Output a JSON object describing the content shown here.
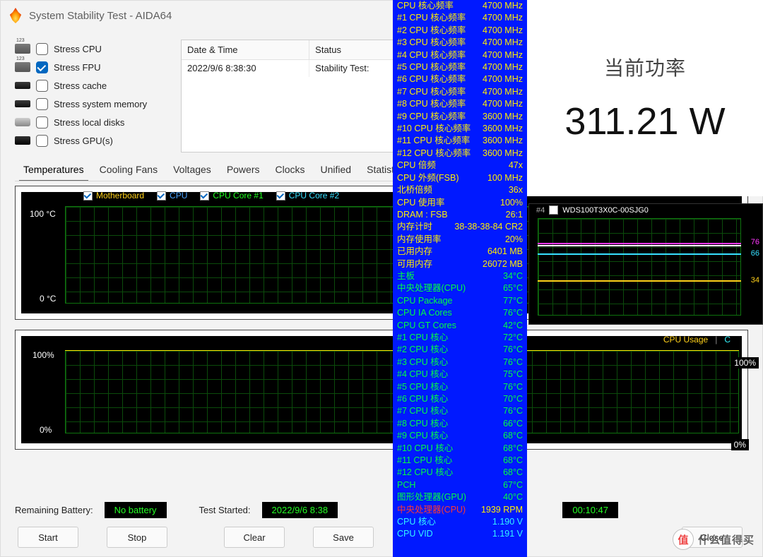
{
  "window": {
    "title": "System Stability Test - AIDA64"
  },
  "stress": {
    "items": [
      {
        "label": "Stress CPU",
        "checked": false,
        "icon": "cpu"
      },
      {
        "label": "Stress FPU",
        "checked": true,
        "icon": "cpu"
      },
      {
        "label": "Stress cache",
        "checked": false,
        "icon": "ram"
      },
      {
        "label": "Stress system memory",
        "checked": false,
        "icon": "ram"
      },
      {
        "label": "Stress local disks",
        "checked": false,
        "icon": "disk"
      },
      {
        "label": "Stress GPU(s)",
        "checked": false,
        "icon": "gpu"
      }
    ]
  },
  "log": {
    "col_date": "Date & Time",
    "col_status": "Status",
    "rows": [
      {
        "dt": "2022/9/6 8:38:30",
        "status": "Stability Test:"
      }
    ]
  },
  "tabs": [
    "Temperatures",
    "Cooling Fans",
    "Voltages",
    "Powers",
    "Clocks",
    "Unified",
    "Statistic"
  ],
  "active_tab": "Temperatures",
  "temp_graph": {
    "y_top": "100 °C",
    "y_bot": "0 °C",
    "legend": [
      {
        "label": "Motherboard",
        "color": "legend-yellow"
      },
      {
        "label": "CPU",
        "color": "legend-blue"
      },
      {
        "label": "CPU Core #1",
        "color": "legend-green"
      },
      {
        "label": "CPU Core #2",
        "color": "legend-cyan"
      }
    ]
  },
  "usage_graph": {
    "y_top": "100%",
    "y_bot": "0%",
    "legend_left": "CPU Usage",
    "sep": "|",
    "legend_right_frag": "C"
  },
  "mini": {
    "idx": "#4",
    "device": "WDS100T3X0C-00SJG0",
    "vals": {
      "v76a": "76",
      "v76b": "76",
      "v66": "66",
      "v34": "34"
    }
  },
  "status": {
    "battery_label": "Remaining Battery:",
    "battery_value": "No battery",
    "started_label": "Test Started:",
    "started_value": "2022/9/6 8:38",
    "elapsed": "00:10:47"
  },
  "buttons": {
    "start": "Start",
    "stop": "Stop",
    "clear": "Clear",
    "save": "Save",
    "close": "Close"
  },
  "power": {
    "title": "当前功率",
    "value": "311.21 W"
  },
  "monitor": [
    {
      "lab": "CPU 核心频率",
      "val": "4700 MHz",
      "lc": "mlab",
      "vc": "mval"
    },
    {
      "lab": "#1 CPU 核心频率",
      "val": "4700 MHz",
      "lc": "mlab",
      "vc": "mval"
    },
    {
      "lab": "#2 CPU 核心频率",
      "val": "4700 MHz",
      "lc": "mlab",
      "vc": "mval"
    },
    {
      "lab": "#3 CPU 核心频率",
      "val": "4700 MHz",
      "lc": "mlab",
      "vc": "mval"
    },
    {
      "lab": "#4 CPU 核心频率",
      "val": "4700 MHz",
      "lc": "mlab",
      "vc": "mval"
    },
    {
      "lab": "#5 CPU 核心频率",
      "val": "4700 MHz",
      "lc": "mlab",
      "vc": "mval"
    },
    {
      "lab": "#6 CPU 核心频率",
      "val": "4700 MHz",
      "lc": "mlab",
      "vc": "mval"
    },
    {
      "lab": "#7 CPU 核心频率",
      "val": "4700 MHz",
      "lc": "mlab",
      "vc": "mval"
    },
    {
      "lab": "#8 CPU 核心频率",
      "val": "4700 MHz",
      "lc": "mlab",
      "vc": "mval"
    },
    {
      "lab": "#9 CPU 核心频率",
      "val": "3600 MHz",
      "lc": "mlab",
      "vc": "mval"
    },
    {
      "lab": "#10 CPU 核心频率",
      "val": "3600 MHz",
      "lc": "mlab",
      "vc": "mval"
    },
    {
      "lab": "#11 CPU 核心频率",
      "val": "3600 MHz",
      "lc": "mlab",
      "vc": "mval"
    },
    {
      "lab": "#12 CPU 核心频率",
      "val": "3600 MHz",
      "lc": "mlab",
      "vc": "mval"
    },
    {
      "lab": "CPU 倍频",
      "val": "47x",
      "lc": "mlab",
      "vc": "mval"
    },
    {
      "lab": "CPU 外频(FSB)",
      "val": "100 MHz",
      "lc": "mlab",
      "vc": "mval"
    },
    {
      "lab": "北桥倍频",
      "val": "36x",
      "lc": "mlab",
      "vc": "mval"
    },
    {
      "lab": "CPU 使用率",
      "val": "100%",
      "lc": "mlab",
      "vc": "mval"
    },
    {
      "lab": "DRAM : FSB",
      "val": "26:1",
      "lc": "mlab",
      "vc": "mval"
    },
    {
      "lab": "内存计时",
      "val": "38-38-38-84 CR2",
      "lc": "mlab",
      "vc": "mval"
    },
    {
      "lab": "内存使用率",
      "val": "20%",
      "lc": "mlab",
      "vc": "mval"
    },
    {
      "lab": "已用内存",
      "val": "6401 MB",
      "lc": "mlab",
      "vc": "mval"
    },
    {
      "lab": "可用内存",
      "val": "26072 MB",
      "lc": "mlab",
      "vc": "mval"
    },
    {
      "lab": "主板",
      "val": "34°C",
      "lc": "mlab green",
      "vc": "mval green"
    },
    {
      "lab": "中央处理器(CPU)",
      "val": "65°C",
      "lc": "mlab green",
      "vc": "mval green"
    },
    {
      "lab": "CPU Package",
      "val": "77°C",
      "lc": "mlab green",
      "vc": "mval green"
    },
    {
      "lab": "CPU IA Cores",
      "val": "76°C",
      "lc": "mlab green",
      "vc": "mval green"
    },
    {
      "lab": "CPU GT Cores",
      "val": "42°C",
      "lc": "mlab green",
      "vc": "mval green"
    },
    {
      "lab": "#1 CPU 核心",
      "val": "72°C",
      "lc": "mlab green",
      "vc": "mval green"
    },
    {
      "lab": "#2 CPU 核心",
      "val": "76°C",
      "lc": "mlab green",
      "vc": "mval green"
    },
    {
      "lab": "#3 CPU 核心",
      "val": "76°C",
      "lc": "mlab green",
      "vc": "mval green"
    },
    {
      "lab": "#4 CPU 核心",
      "val": "75°C",
      "lc": "mlab green",
      "vc": "mval green"
    },
    {
      "lab": "#5 CPU 核心",
      "val": "76°C",
      "lc": "mlab green",
      "vc": "mval green"
    },
    {
      "lab": "#6 CPU 核心",
      "val": "70°C",
      "lc": "mlab green",
      "vc": "mval green"
    },
    {
      "lab": "#7 CPU 核心",
      "val": "76°C",
      "lc": "mlab green",
      "vc": "mval green"
    },
    {
      "lab": "#8 CPU 核心",
      "val": "66°C",
      "lc": "mlab green",
      "vc": "mval green"
    },
    {
      "lab": "#9 CPU 核心",
      "val": "68°C",
      "lc": "mlab green",
      "vc": "mval green"
    },
    {
      "lab": "#10 CPU 核心",
      "val": "68°C",
      "lc": "mlab green",
      "vc": "mval green"
    },
    {
      "lab": "#11 CPU 核心",
      "val": "68°C",
      "lc": "mlab green",
      "vc": "mval green"
    },
    {
      "lab": "#12 CPU 核心",
      "val": "68°C",
      "lc": "mlab green",
      "vc": "mval green"
    },
    {
      "lab": "PCH",
      "val": "67°C",
      "lc": "mlab green",
      "vc": "mval green"
    },
    {
      "lab": "图形处理器(GPU)",
      "val": "40°C",
      "lc": "mlab green",
      "vc": "mval green"
    },
    {
      "lab": "中央处理器(CPU)",
      "val": "1939 RPM",
      "lc": "mlab red",
      "vc": "mval"
    },
    {
      "lab": "CPU 核心",
      "val": "1.190 V",
      "lc": "mlab cyan",
      "vc": "mval cyan"
    },
    {
      "lab": "CPU VID",
      "val": "1.191 V",
      "lc": "mlab cyan",
      "vc": "mval cyan"
    }
  ],
  "watermark": {
    "glyph": "值",
    "text": "什么值得买"
  },
  "chart_data": [
    {
      "type": "line",
      "title": "Temperatures",
      "ylabel": "°C",
      "ylim": [
        0,
        100
      ],
      "series": [
        {
          "name": "Motherboard",
          "current": 34
        },
        {
          "name": "CPU",
          "current": 65
        },
        {
          "name": "CPU Core #1",
          "current": 72
        },
        {
          "name": "CPU Core #2",
          "current": 76
        }
      ]
    },
    {
      "type": "line",
      "title": "CPU Usage",
      "ylabel": "%",
      "ylim": [
        0,
        100
      ],
      "series": [
        {
          "name": "CPU Usage",
          "current": 100
        }
      ]
    },
    {
      "type": "line",
      "title": "#4 WDS100T3X0C-00SJG0",
      "ylabel": "°C",
      "ylim": [
        0,
        100
      ],
      "right_axis_values": [
        76,
        76,
        66,
        34
      ],
      "series": [
        {
          "name": "line-yellow",
          "current": 34
        },
        {
          "name": "line-cyan",
          "current": 66
        },
        {
          "name": "line-magenta",
          "current": 76
        },
        {
          "name": "line-white",
          "current": 76
        }
      ]
    }
  ]
}
